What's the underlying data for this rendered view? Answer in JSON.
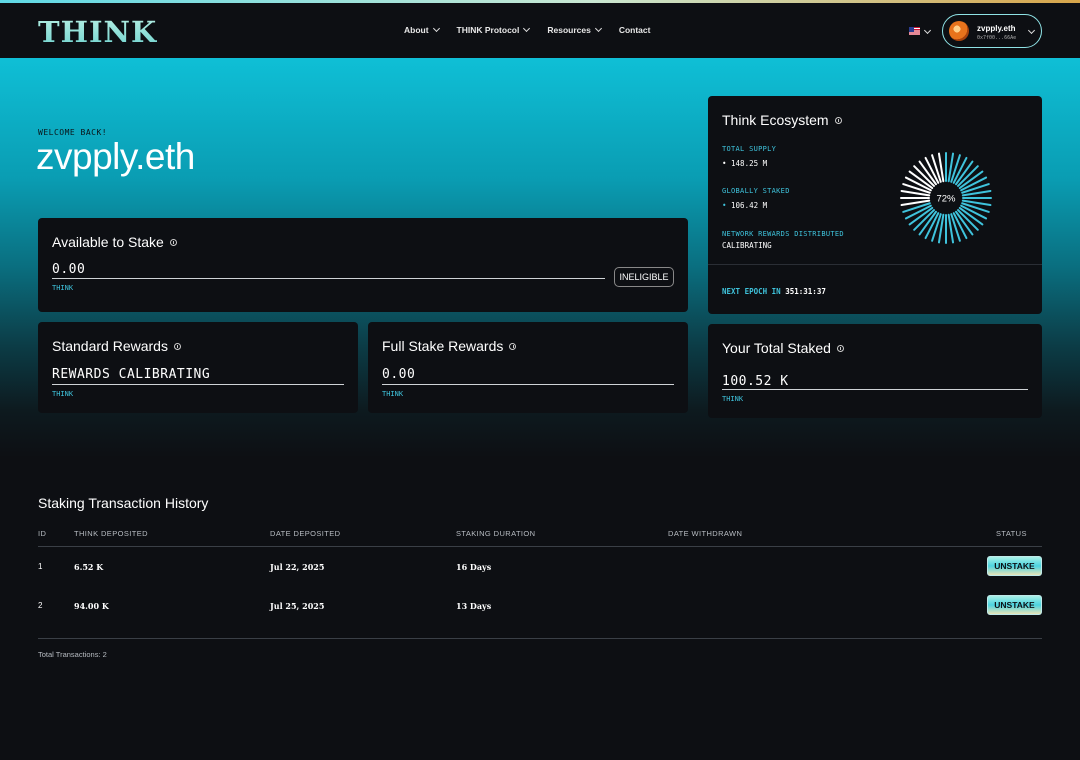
{
  "header": {
    "logo": "THINK",
    "nav": [
      {
        "label": "About",
        "has_dropdown": true
      },
      {
        "label": "THINK Protocol",
        "has_dropdown": true
      },
      {
        "label": "Resources",
        "has_dropdown": true
      },
      {
        "label": "Contact",
        "has_dropdown": false
      }
    ],
    "wallet": {
      "name": "zvpply.eth",
      "address": "0x7f00...66Ae"
    }
  },
  "hero": {
    "welcome": "WELCOME BACK!",
    "name": "zvpply.eth"
  },
  "available": {
    "title": "Available to Stake",
    "value": "0.00",
    "unit": "THINK",
    "button": "INELIGIBLE"
  },
  "standard": {
    "title": "Standard Rewards",
    "value": "REWARDS CALIBRATING",
    "unit": "THINK"
  },
  "fullstake": {
    "title": "Full Stake Rewards",
    "value": "0.00",
    "unit": "THINK"
  },
  "ecosystem": {
    "title": "Think Ecosystem",
    "total_supply_label": "TOTAL SUPPLY",
    "total_supply": "148.25 M",
    "globally_staked_label": "GLOBALLY STAKED",
    "globally_staked": "106.42 M",
    "rewards_label": "NETWORK REWARDS DISTRIBUTED",
    "rewards": "CALIBRATING",
    "percent_label": "72%",
    "staked_fraction": 0.72,
    "epoch_label": "NEXT EPOCH IN",
    "epoch_value": "351:31:37",
    "accent_color": "#3fc3dc"
  },
  "total_staked": {
    "title": "Your Total Staked",
    "value": "100.52 K",
    "unit": "THINK"
  },
  "history": {
    "title": "Staking Transaction History",
    "columns": [
      "ID",
      "THINK DEPOSITED",
      "DATE DEPOSITED",
      "STAKING DURATION",
      "DATE WITHDRAWN",
      "STATUS"
    ],
    "rows": [
      {
        "id": "1",
        "deposited": "6.52 K",
        "date": "Jul 22, 2025",
        "duration": "16 Days",
        "withdrawn": "",
        "action": "UNSTAKE"
      },
      {
        "id": "2",
        "deposited": "94.00 K",
        "date": "Jul 25, 2025",
        "duration": "13 Days",
        "withdrawn": "",
        "action": "UNSTAKE"
      }
    ],
    "total": "Total Transactions: 2"
  }
}
